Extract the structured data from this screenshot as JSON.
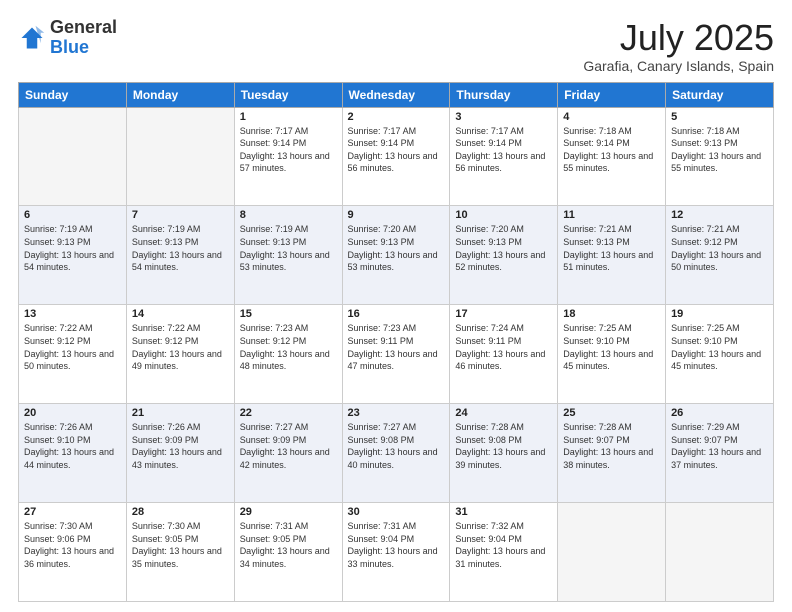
{
  "header": {
    "logo_general": "General",
    "logo_blue": "Blue",
    "main_title": "July 2025",
    "sub_title": "Garafia, Canary Islands, Spain"
  },
  "days_of_week": [
    "Sunday",
    "Monday",
    "Tuesday",
    "Wednesday",
    "Thursday",
    "Friday",
    "Saturday"
  ],
  "weeks": [
    [
      {
        "day": "",
        "info": ""
      },
      {
        "day": "",
        "info": ""
      },
      {
        "day": "1",
        "info": "Sunrise: 7:17 AM\nSunset: 9:14 PM\nDaylight: 13 hours and 57 minutes."
      },
      {
        "day": "2",
        "info": "Sunrise: 7:17 AM\nSunset: 9:14 PM\nDaylight: 13 hours and 56 minutes."
      },
      {
        "day": "3",
        "info": "Sunrise: 7:17 AM\nSunset: 9:14 PM\nDaylight: 13 hours and 56 minutes."
      },
      {
        "day": "4",
        "info": "Sunrise: 7:18 AM\nSunset: 9:14 PM\nDaylight: 13 hours and 55 minutes."
      },
      {
        "day": "5",
        "info": "Sunrise: 7:18 AM\nSunset: 9:13 PM\nDaylight: 13 hours and 55 minutes."
      }
    ],
    [
      {
        "day": "6",
        "info": "Sunrise: 7:19 AM\nSunset: 9:13 PM\nDaylight: 13 hours and 54 minutes."
      },
      {
        "day": "7",
        "info": "Sunrise: 7:19 AM\nSunset: 9:13 PM\nDaylight: 13 hours and 54 minutes."
      },
      {
        "day": "8",
        "info": "Sunrise: 7:19 AM\nSunset: 9:13 PM\nDaylight: 13 hours and 53 minutes."
      },
      {
        "day": "9",
        "info": "Sunrise: 7:20 AM\nSunset: 9:13 PM\nDaylight: 13 hours and 53 minutes."
      },
      {
        "day": "10",
        "info": "Sunrise: 7:20 AM\nSunset: 9:13 PM\nDaylight: 13 hours and 52 minutes."
      },
      {
        "day": "11",
        "info": "Sunrise: 7:21 AM\nSunset: 9:13 PM\nDaylight: 13 hours and 51 minutes."
      },
      {
        "day": "12",
        "info": "Sunrise: 7:21 AM\nSunset: 9:12 PM\nDaylight: 13 hours and 50 minutes."
      }
    ],
    [
      {
        "day": "13",
        "info": "Sunrise: 7:22 AM\nSunset: 9:12 PM\nDaylight: 13 hours and 50 minutes."
      },
      {
        "day": "14",
        "info": "Sunrise: 7:22 AM\nSunset: 9:12 PM\nDaylight: 13 hours and 49 minutes."
      },
      {
        "day": "15",
        "info": "Sunrise: 7:23 AM\nSunset: 9:12 PM\nDaylight: 13 hours and 48 minutes."
      },
      {
        "day": "16",
        "info": "Sunrise: 7:23 AM\nSunset: 9:11 PM\nDaylight: 13 hours and 47 minutes."
      },
      {
        "day": "17",
        "info": "Sunrise: 7:24 AM\nSunset: 9:11 PM\nDaylight: 13 hours and 46 minutes."
      },
      {
        "day": "18",
        "info": "Sunrise: 7:25 AM\nSunset: 9:10 PM\nDaylight: 13 hours and 45 minutes."
      },
      {
        "day": "19",
        "info": "Sunrise: 7:25 AM\nSunset: 9:10 PM\nDaylight: 13 hours and 45 minutes."
      }
    ],
    [
      {
        "day": "20",
        "info": "Sunrise: 7:26 AM\nSunset: 9:10 PM\nDaylight: 13 hours and 44 minutes."
      },
      {
        "day": "21",
        "info": "Sunrise: 7:26 AM\nSunset: 9:09 PM\nDaylight: 13 hours and 43 minutes."
      },
      {
        "day": "22",
        "info": "Sunrise: 7:27 AM\nSunset: 9:09 PM\nDaylight: 13 hours and 42 minutes."
      },
      {
        "day": "23",
        "info": "Sunrise: 7:27 AM\nSunset: 9:08 PM\nDaylight: 13 hours and 40 minutes."
      },
      {
        "day": "24",
        "info": "Sunrise: 7:28 AM\nSunset: 9:08 PM\nDaylight: 13 hours and 39 minutes."
      },
      {
        "day": "25",
        "info": "Sunrise: 7:28 AM\nSunset: 9:07 PM\nDaylight: 13 hours and 38 minutes."
      },
      {
        "day": "26",
        "info": "Sunrise: 7:29 AM\nSunset: 9:07 PM\nDaylight: 13 hours and 37 minutes."
      }
    ],
    [
      {
        "day": "27",
        "info": "Sunrise: 7:30 AM\nSunset: 9:06 PM\nDaylight: 13 hours and 36 minutes."
      },
      {
        "day": "28",
        "info": "Sunrise: 7:30 AM\nSunset: 9:05 PM\nDaylight: 13 hours and 35 minutes."
      },
      {
        "day": "29",
        "info": "Sunrise: 7:31 AM\nSunset: 9:05 PM\nDaylight: 13 hours and 34 minutes."
      },
      {
        "day": "30",
        "info": "Sunrise: 7:31 AM\nSunset: 9:04 PM\nDaylight: 13 hours and 33 minutes."
      },
      {
        "day": "31",
        "info": "Sunrise: 7:32 AM\nSunset: 9:04 PM\nDaylight: 13 hours and 31 minutes."
      },
      {
        "day": "",
        "info": ""
      },
      {
        "day": "",
        "info": ""
      }
    ]
  ]
}
